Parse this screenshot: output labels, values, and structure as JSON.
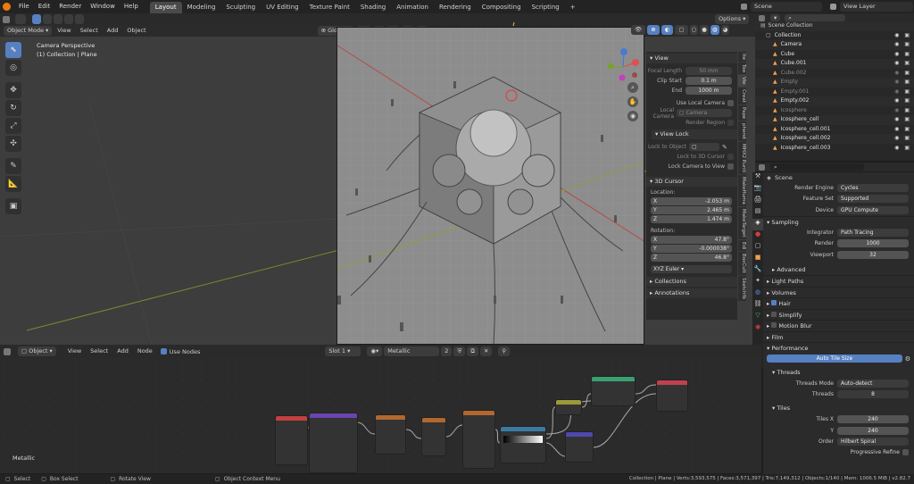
{
  "menu": {
    "items": [
      "File",
      "Edit",
      "Render",
      "Window",
      "Help"
    ]
  },
  "workspaces": {
    "tabs": [
      "Layout",
      "Modeling",
      "Sculpting",
      "UV Editing",
      "Texture Paint",
      "Shading",
      "Animation",
      "Rendering",
      "Compositing",
      "Scripting"
    ],
    "active": "Layout"
  },
  "scene": {
    "name": "Scene",
    "view_layer": "View Layer"
  },
  "viewport": {
    "mode": "Object Mode",
    "menus": [
      "View",
      "Select",
      "Add",
      "Object"
    ],
    "transform": "Global",
    "options": "Options",
    "overlay_title": "Camera Perspective",
    "overlay_sub": "(1) Collection | Plane"
  },
  "npanel": {
    "view_header": "View",
    "focal_label": "Focal Length",
    "focal_value": "50 mm",
    "clip_start_label": "Clip Start",
    "clip_start_value": "0.1 m",
    "end_label": "End",
    "end_value": "1000 m",
    "use_local_camera": "Use Local Camera",
    "local_camera_label": "Local Camera",
    "local_camera_value": "Camera",
    "render_region": "Render Region",
    "view_lock_header": "View Lock",
    "lock_to_object": "Lock to Object",
    "lock_3d_cursor": "Lock to 3D Cursor",
    "lock_camera_to_view": "Lock Camera to View",
    "cursor_header": "3D Cursor",
    "location_label": "Location:",
    "loc": [
      {
        "axis": "X",
        "value": "-2.053 m"
      },
      {
        "axis": "Y",
        "value": "2.465 m"
      },
      {
        "axis": "Z",
        "value": "1.474 m"
      }
    ],
    "rotation_label": "Rotation:",
    "rot": [
      {
        "axis": "X",
        "value": "47.8°"
      },
      {
        "axis": "Y",
        "value": "-0.000038°"
      },
      {
        "axis": "Z",
        "value": "46.8°"
      }
    ],
    "rotation_mode": "XYZ Euler",
    "collections": "Collections",
    "annotations": "Annotations"
  },
  "vtabs": [
    "Ite",
    "Too",
    "Vie",
    "Creat",
    "Pape",
    "pherot",
    "MHX2 Runti",
    "MakeHuma",
    "MakeTarget",
    "Edi",
    "BoxCutt",
    "Sketchfb"
  ],
  "outliner": {
    "root": "Scene Collection",
    "items": [
      {
        "name": "Collection",
        "color": "#e0e0e0",
        "dim": false
      },
      {
        "name": "Camera",
        "color": "#e0e0e0",
        "dim": false
      },
      {
        "name": "Cube",
        "color": "#e0e0e0",
        "dim": false
      },
      {
        "name": "Cube.001",
        "color": "#e0e0e0",
        "dim": false
      },
      {
        "name": "Cube.002",
        "color": "#8a8a8a",
        "dim": true
      },
      {
        "name": "Empty",
        "color": "#8a8a8a",
        "dim": true
      },
      {
        "name": "Empty.001",
        "color": "#8a8a8a",
        "dim": true
      },
      {
        "name": "Empty.002",
        "color": "#e0e0e0",
        "dim": false
      },
      {
        "name": "Icosphere",
        "color": "#8a8a8a",
        "dim": true
      },
      {
        "name": "Icosphere_cell",
        "color": "#e0e0e0",
        "dim": false
      },
      {
        "name": "Icosphere_cell.001",
        "color": "#e0e0e0",
        "dim": false
      },
      {
        "name": "Icosphere_cell.002",
        "color": "#e0e0e0",
        "dim": false
      },
      {
        "name": "Icosphere_cell.003",
        "color": "#e0e0e0",
        "dim": false
      }
    ]
  },
  "properties": {
    "context": "Scene",
    "render_engine_label": "Render Engine",
    "render_engine": "Cycles",
    "feature_set_label": "Feature Set",
    "feature_set": "Supported",
    "device_label": "Device",
    "device": "GPU Compute",
    "sampling": "Sampling",
    "integrator_label": "Integrator",
    "integrator": "Path Tracing",
    "render_label": "Render",
    "render_samples": "1000",
    "viewport_label": "Viewport",
    "viewport_samples": "32",
    "advanced": "Advanced",
    "light_paths": "Light Paths",
    "volumes": "Volumes",
    "hair": "Hair",
    "simplify": "Simplify",
    "motion_blur": "Motion Blur",
    "film": "Film",
    "performance": "Performance",
    "auto_tile": "Auto Tile Size",
    "threads": "Threads",
    "threads_mode_label": "Threads Mode",
    "threads_mode": "Auto-detect",
    "threads_label": "Threads",
    "threads_value": "8",
    "tiles": "Tiles",
    "tiles_x_label": "Tiles X",
    "tiles_x": "240",
    "y_label": "Y",
    "tiles_y": "240",
    "order_label": "Order",
    "order": "Hilbert Spiral",
    "progressive_refine": "Progressive Refine"
  },
  "node_editor": {
    "type": "Object",
    "menus": [
      "View",
      "Select",
      "Add",
      "Node"
    ],
    "use_nodes": "Use Nodes",
    "slot": "Slot 1",
    "material": "Metallic",
    "users": "2",
    "material_label": "Metallic"
  },
  "statusbar": {
    "select": "Select",
    "box_select": "Box Select",
    "rotate_view": "Rotate View",
    "context_menu": "Object Context Menu",
    "stats": "Collection | Plane | Verts:3,593,575 | Faces:3,571,397 | Tris:7,149,312 | Objects:1/140 | Mem: 1006.5 MiB | v2.82.7"
  },
  "colors": {
    "accent": "#5680c2",
    "selected_orange": "#f0a050",
    "bg": "#1d1d1d",
    "panel": "#2b2b2b"
  }
}
